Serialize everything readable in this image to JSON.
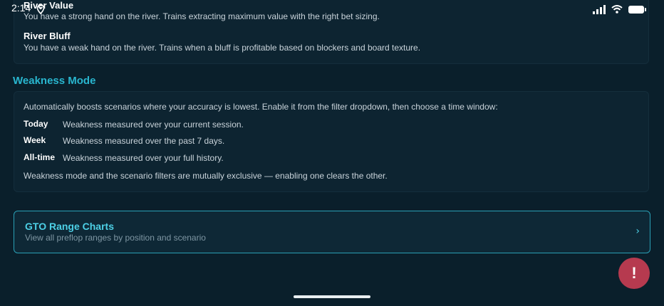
{
  "status_bar": {
    "time": "2:14"
  },
  "modes": [
    {
      "title": "River Value",
      "description": "You have a strong hand on the river. Trains extracting maximum value with the right bet sizing."
    },
    {
      "title": "River Bluff",
      "description": "You have a weak hand on the river. Trains when a bluff is profitable based on blockers and board texture."
    }
  ],
  "weakness": {
    "heading": "Weakness Mode",
    "intro": "Automatically boosts scenarios where your accuracy is lowest. Enable it from the filter dropdown, then choose a time window:",
    "windows": [
      {
        "label": "Today",
        "description": "Weakness measured over your current session."
      },
      {
        "label": "Week",
        "description": "Weakness measured over the past 7 days."
      },
      {
        "label": "All-time",
        "description": "Weakness measured over your full history."
      }
    ],
    "note": "Weakness mode and the scenario filters are mutually exclusive — enabling one clears the other."
  },
  "gto_link": {
    "title": "GTO Range Charts",
    "subtitle": "View all preflop ranges by position and scenario",
    "chevron": "›"
  },
  "fab": {
    "label": "!",
    "icon": "alert-icon",
    "color": "#b63a4f"
  },
  "colors": {
    "accent": "#29b6cf",
    "background": "#0a1f2b",
    "card": "#0d2431"
  }
}
